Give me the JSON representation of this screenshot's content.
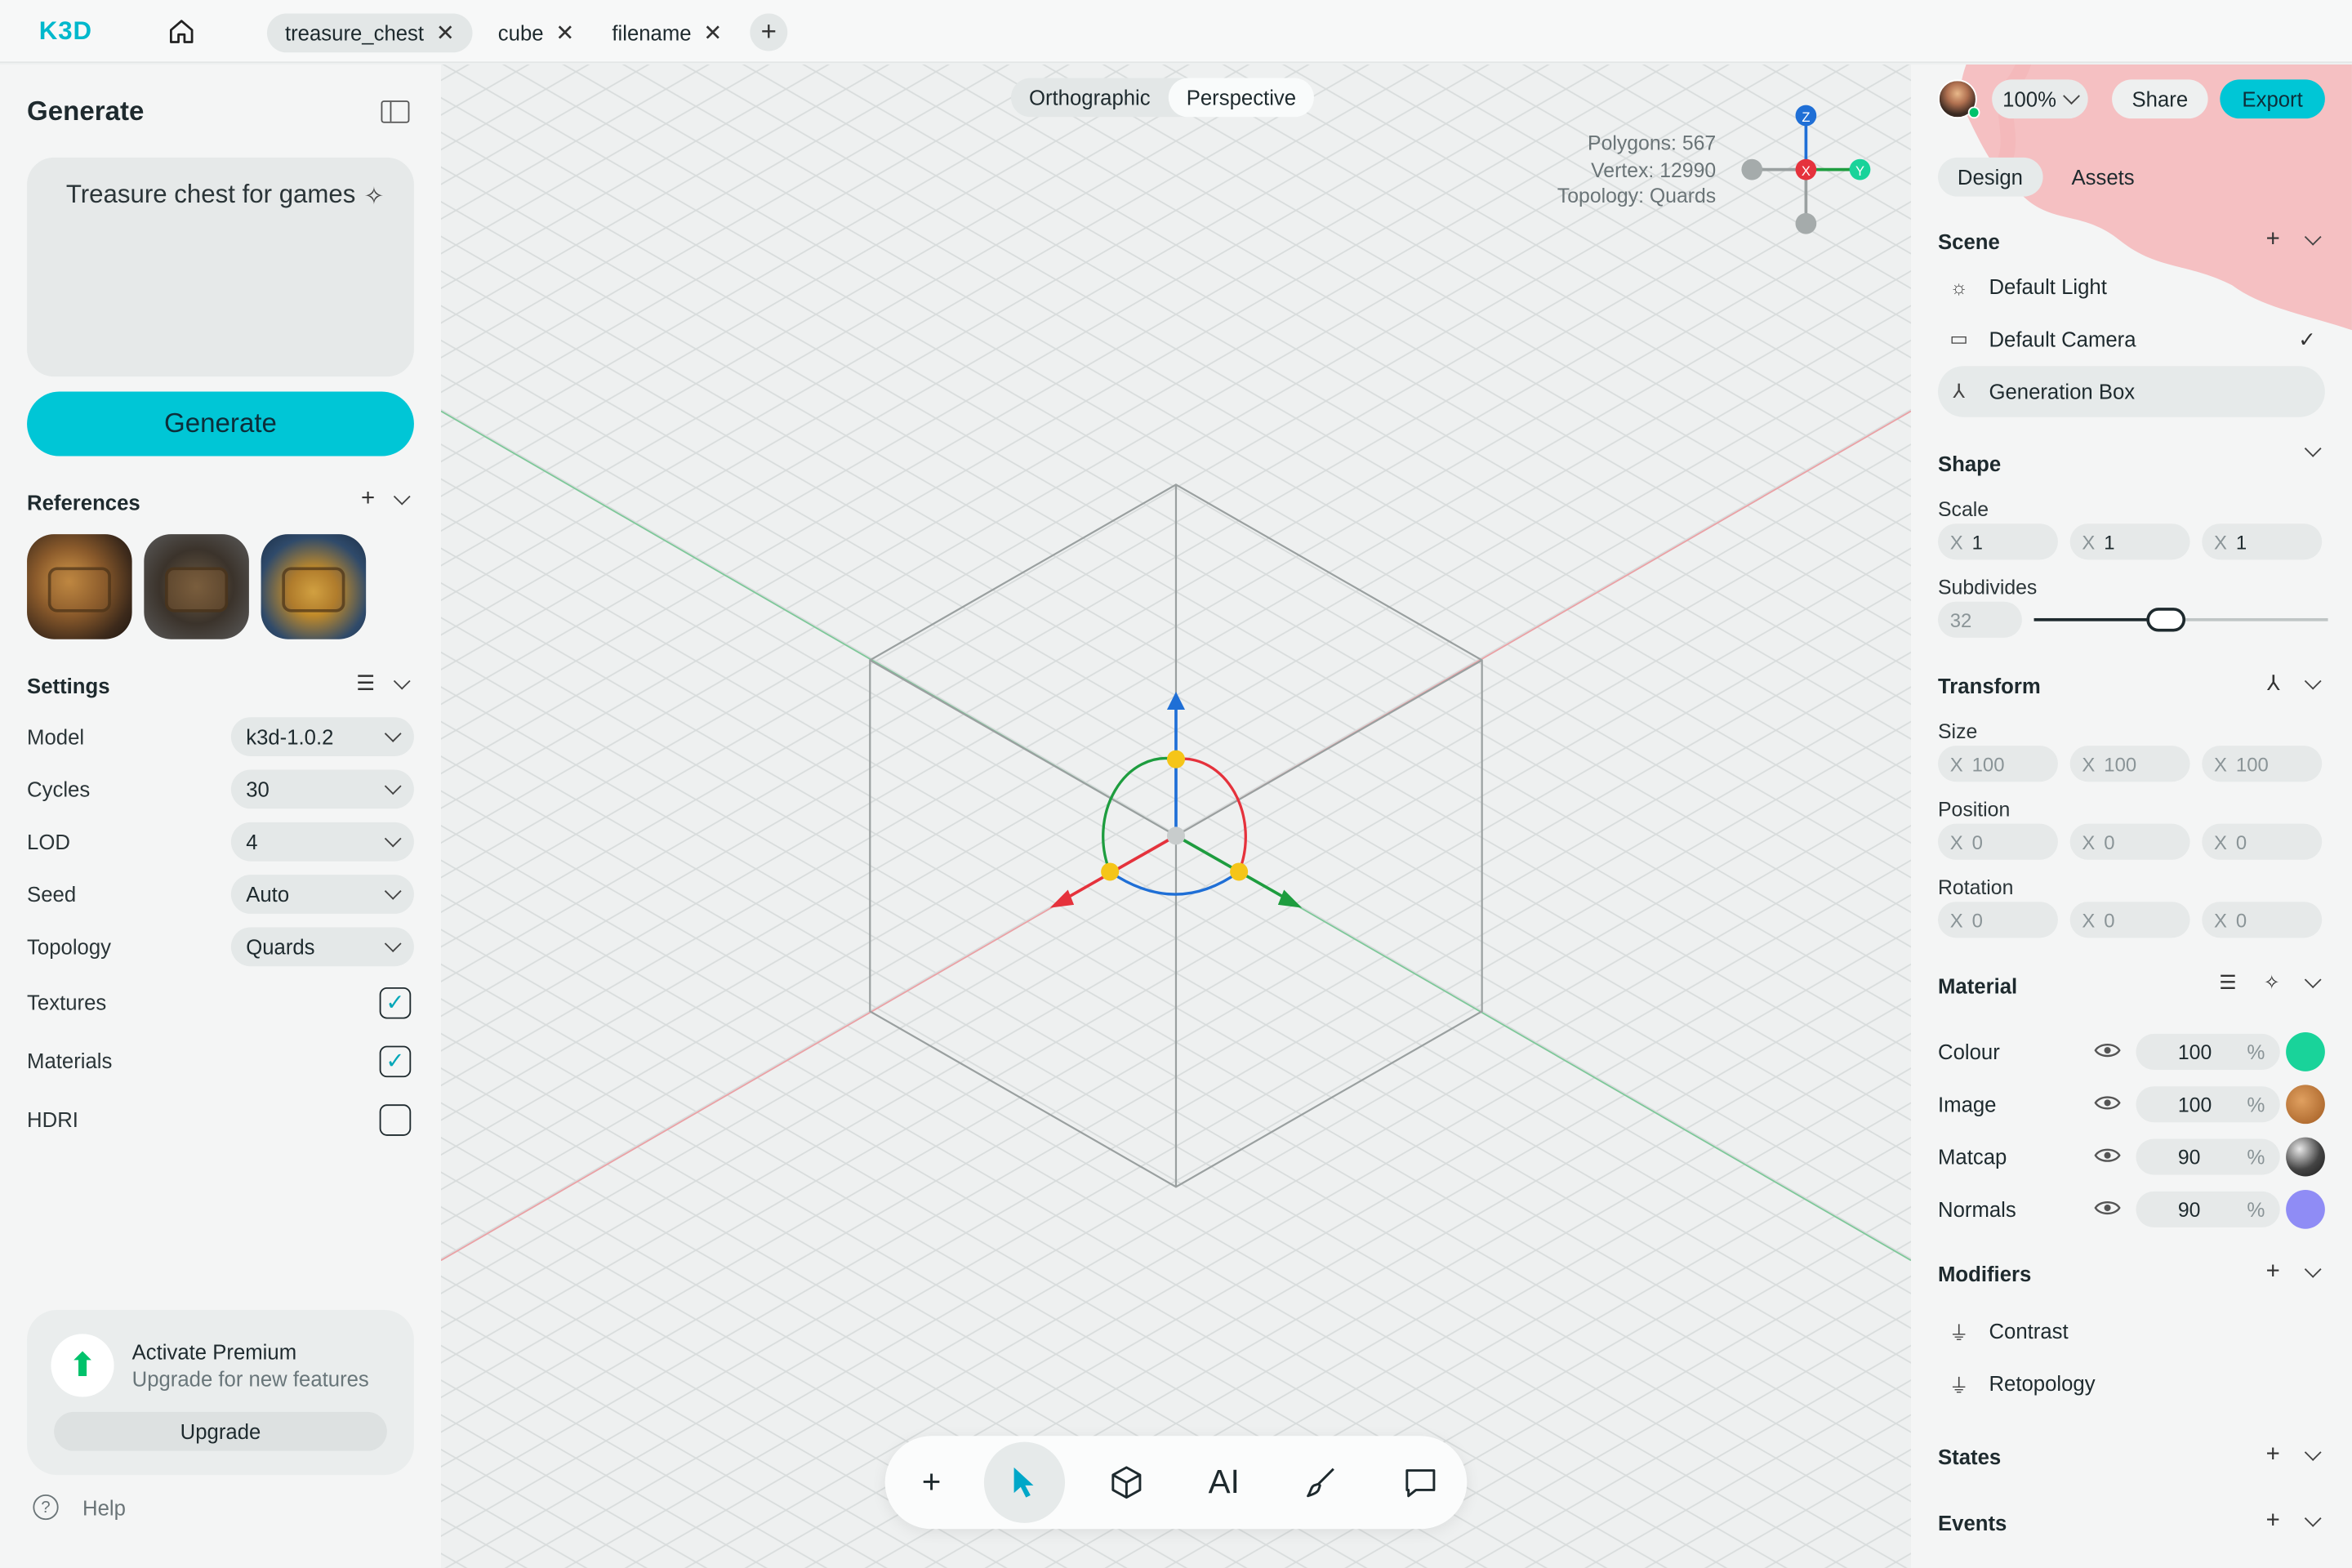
{
  "topbar": {
    "logo": "K3D",
    "tabs": [
      {
        "label": "treasure_chest",
        "active": true
      },
      {
        "label": "cube",
        "active": false
      },
      {
        "label": "filename",
        "active": false
      }
    ]
  },
  "left": {
    "title": "Generate",
    "prompt": "Treasure chest for games",
    "generate_label": "Generate",
    "references_label": "References",
    "settings_label": "Settings",
    "settings": [
      {
        "label": "Model",
        "value": "k3d-1.0.2"
      },
      {
        "label": "Cycles",
        "value": "30"
      },
      {
        "label": "LOD",
        "value": "4"
      },
      {
        "label": "Seed",
        "value": "Auto"
      },
      {
        "label": "Topology",
        "value": "Quards"
      }
    ],
    "toggles": [
      {
        "label": "Textures",
        "checked": true
      },
      {
        "label": "Materials",
        "checked": true
      },
      {
        "label": "HDRI",
        "checked": false
      }
    ],
    "premium": {
      "title": "Activate Premium",
      "subtitle": "Upgrade for new features",
      "button": "Upgrade"
    },
    "help": "Help"
  },
  "viewport": {
    "view_modes": [
      "Orthographic",
      "Perspective"
    ],
    "selected_view": "Perspective",
    "stats": {
      "polygons": "Polygons: 567",
      "vertex": "Vertex: 12990",
      "topology": "Topology: Quards"
    },
    "gizmo": {
      "z": "Z",
      "x": "X",
      "y": "Y"
    }
  },
  "right": {
    "zoom": "100%",
    "share": "Share",
    "export": "Export",
    "tabs": [
      "Design",
      "Assets"
    ],
    "scene_label": "Scene",
    "scene_items": [
      {
        "label": "Default Light",
        "icon": "sun-icon"
      },
      {
        "label": "Default Camera",
        "icon": "camera-icon",
        "checked": true
      },
      {
        "label": "Generation Box",
        "icon": "axis-icon",
        "selected": true
      }
    ],
    "shape_label": "Shape",
    "scale_label": "Scale",
    "axis_prefix": "X",
    "scale": [
      "1",
      "1",
      "1"
    ],
    "subdivides_label": "Subdivides",
    "subdivides": "32",
    "subdivides_fraction": 0.45,
    "transform_label": "Transform",
    "size_label": "Size",
    "size": [
      "100",
      "100",
      "100"
    ],
    "position_label": "Position",
    "position": [
      "0",
      "0",
      "0"
    ],
    "rotation_label": "Rotation",
    "rotation": [
      "0",
      "0",
      "0"
    ],
    "material_label": "Material",
    "percent": "%",
    "materials": [
      {
        "label": "Colour",
        "value": "100",
        "color": "#19d39a"
      },
      {
        "label": "Image",
        "value": "100",
        "color": "#c47a36"
      },
      {
        "label": "Matcap",
        "value": "90",
        "color": "#3a3a3a"
      },
      {
        "label": "Normals",
        "value": "90",
        "color": "#8f8cf5"
      }
    ],
    "modifiers_label": "Modifiers",
    "modifiers": [
      "Contrast",
      "Retopology"
    ],
    "states_label": "States",
    "events_label": "Events"
  },
  "colors": {
    "accent": "#00c6d6",
    "premium_green": "#00c26b",
    "axis_x": "#e5323c",
    "axis_y": "#1e9d3f",
    "axis_z": "#1f6fd6",
    "handle": "#f5c518"
  }
}
